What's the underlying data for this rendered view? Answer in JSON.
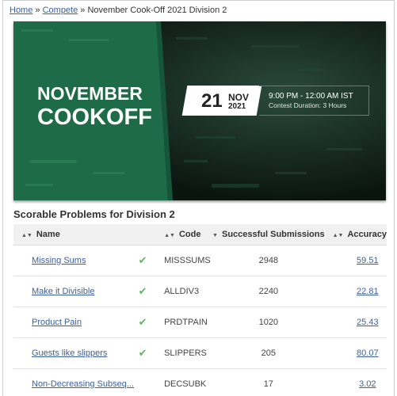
{
  "breadcrumb": {
    "home": "Home",
    "separator1": "»",
    "compete": "Compete",
    "separator2": "»",
    "current": "November Cook-Off 2021 Division 2"
  },
  "banner": {
    "title_line1": "NOVEMBER",
    "title_line2": "COOKOFF",
    "day": "21",
    "month": "NOV",
    "year": "2021",
    "time": "9:00 PM - 12:00 AM IST",
    "duration": "Contest Duration: 3 Hours",
    "green": "#1e6b47",
    "dark": "#0d1a12"
  },
  "section_title": "Scorable Problems for Division 2",
  "table": {
    "headers": {
      "name": "Name",
      "code": "Code",
      "submissions": "Successful Submissions",
      "accuracy": "Accuracy"
    },
    "rows": [
      {
        "name": "Missing Sums",
        "code": "MISSSUMS",
        "submissions": "2948",
        "accuracy": "59.51"
      },
      {
        "name": "Make it Divisible",
        "code": "ALLDIV3",
        "submissions": "2240",
        "accuracy": "22.81"
      },
      {
        "name": "Product Pain",
        "code": "PRDTPAIN",
        "submissions": "1020",
        "accuracy": "25.43"
      },
      {
        "name": "Guests like slippers",
        "code": "SLIPPERS",
        "submissions": "205",
        "accuracy": "80.07"
      },
      {
        "name": "Non-Decreasing Subseq...",
        "code": "DECSUBK",
        "submissions": "17",
        "accuracy": "3.02"
      }
    ],
    "solved_icon": "check-icon",
    "check_color": "#5cb85c"
  }
}
